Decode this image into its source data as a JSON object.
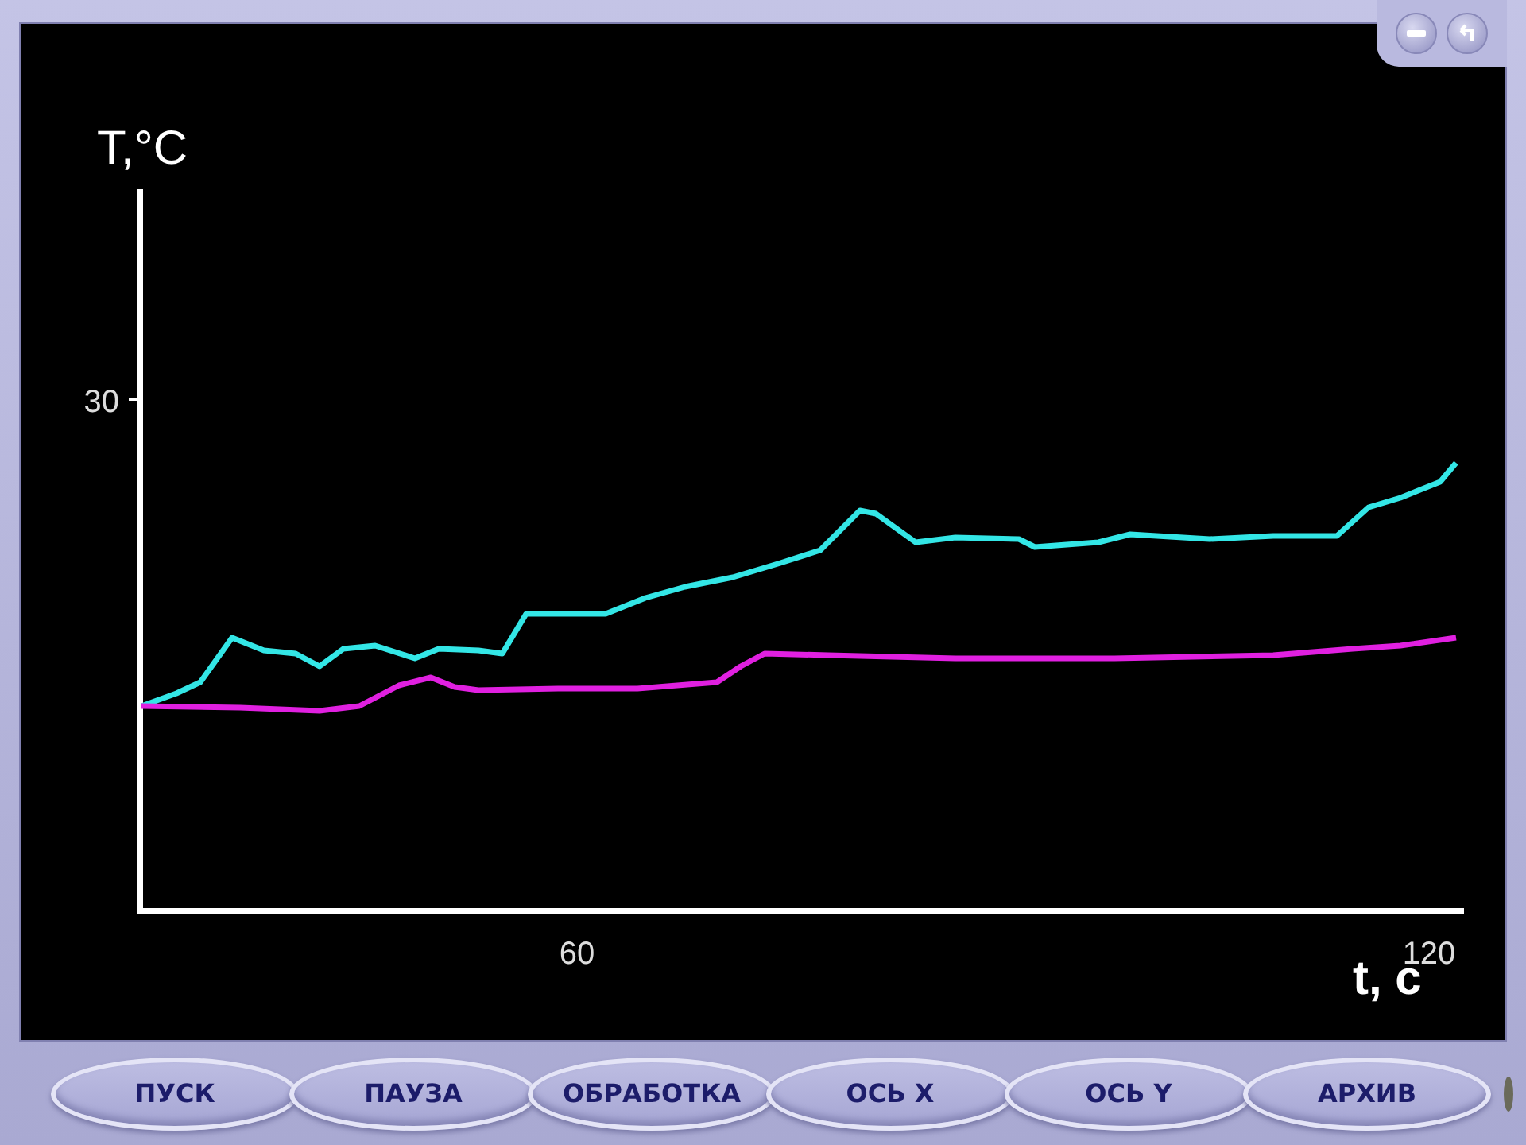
{
  "chart": {
    "y_label": "T,°C",
    "x_label": "t, c",
    "y_ticks": [
      "30"
    ],
    "x_ticks": [
      "60",
      "120"
    ],
    "curves": [
      {
        "color": "#33e6e6"
      },
      {
        "color": "#e020e0"
      }
    ]
  },
  "buttons": [
    "ПУСК",
    "ПАУЗА",
    "ОБРАБОТКА",
    "ОСЬ X",
    "ОСЬ Y",
    "АРХИВ"
  ]
}
